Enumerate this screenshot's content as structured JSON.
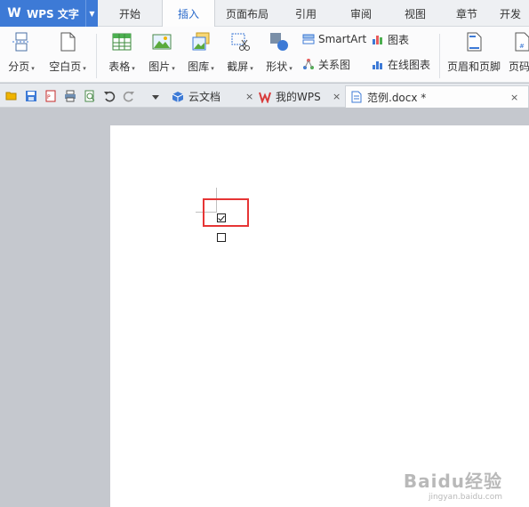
{
  "app": {
    "title": "WPS 文字",
    "logo": "W"
  },
  "menu_tabs": [
    "开始",
    "插入",
    "页面布局",
    "引用",
    "审阅",
    "视图",
    "章节",
    "开发"
  ],
  "ribbon": {
    "page_break": "分页",
    "blank_page": "空白页",
    "table": "表格",
    "picture": "图片",
    "gallery": "图库",
    "screenshot": "截屏",
    "shapes": "形状",
    "smartart": "SmartArt",
    "chart": "图表",
    "relation_chart": "关系图",
    "online_chart": "在线图表",
    "header_footer": "页眉和页脚",
    "page_number": "页码",
    "dropdown_glyph": "▾"
  },
  "doc_tabs": {
    "cloud_docs": "云文档",
    "my_wps": "我的WPS",
    "current_doc": "范例.docx *",
    "close_glyph": "×"
  },
  "watermark": {
    "brand": "Baidu经验",
    "url": "jingyan.baidu.com"
  },
  "colors": {
    "accent": "#3d7ad6",
    "highlight": "#e63535"
  }
}
